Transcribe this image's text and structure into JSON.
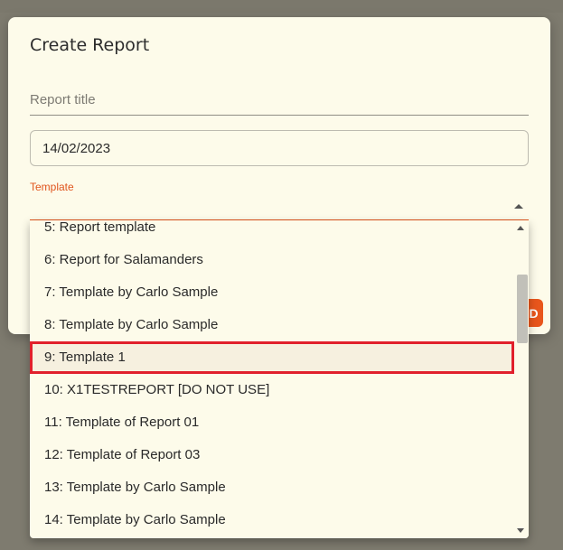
{
  "dialog": {
    "title": "Create Report",
    "report_title_placeholder": "Report title",
    "date_value": "14/02/2023",
    "template_label": "Template",
    "action_button_glyph": "D"
  },
  "template_dropdown": {
    "selected_index": 4,
    "options": [
      "5: Report template",
      "6: Report for Salamanders",
      "7: Template by Carlo Sample",
      "8: Template by Carlo Sample",
      "9: Template 1",
      "10: X1TESTREPORT [DO NOT USE]",
      "11: Template of Report 01",
      "12: Template of Report 03",
      "13: Template by Carlo Sample",
      "14: Template by Carlo Sample"
    ]
  },
  "colors": {
    "accent": "#e0551d",
    "highlight_border": "#e1202c",
    "backdrop": "#7e7b6f",
    "surface": "#fdfbea"
  }
}
